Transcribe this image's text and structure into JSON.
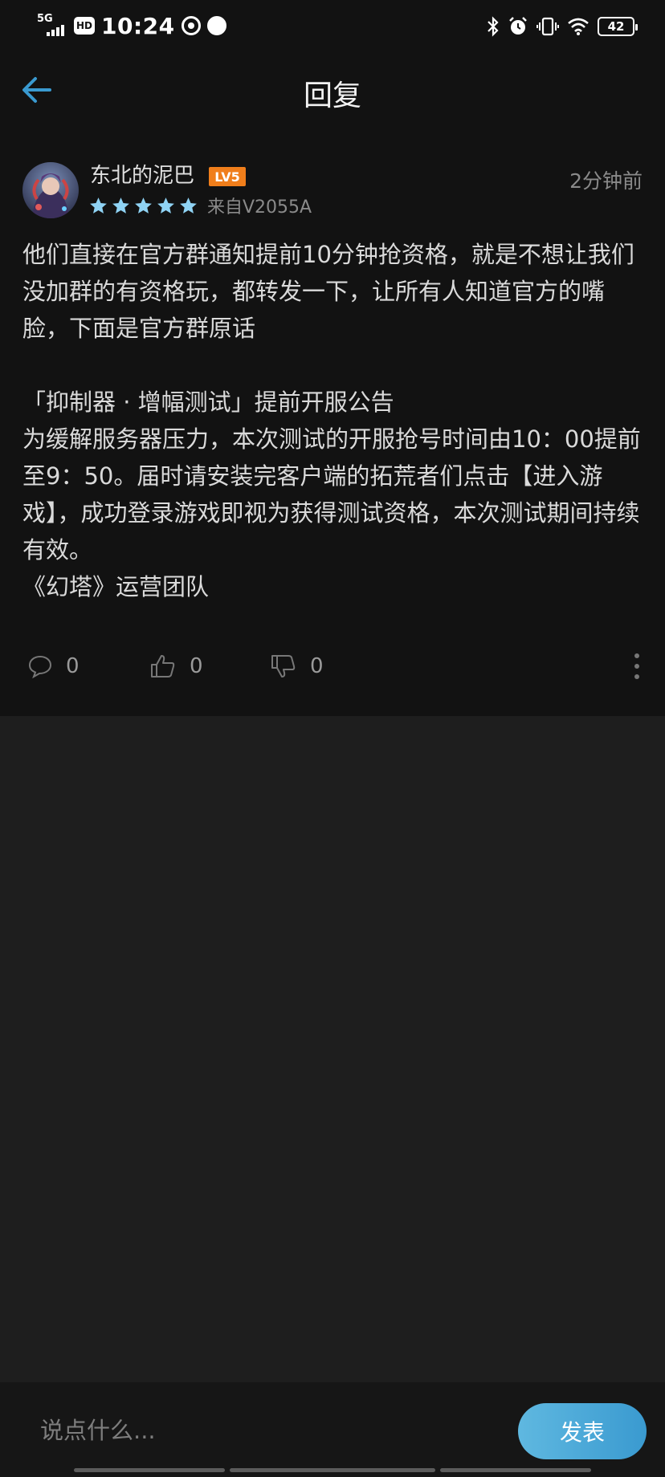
{
  "status_bar": {
    "network": "5G",
    "hd": "HD",
    "time": "10:24",
    "battery": "42"
  },
  "header": {
    "title": "回复"
  },
  "post": {
    "username": "东北的泥巴",
    "level": "LV5",
    "rating_stars": 5,
    "source": "来自V2055A",
    "time_ago": "2分钟前",
    "paragraphs": [
      "他们直接在官方群通知提前10分钟抢资格，就是不想让我们没加群的有资格玩，都转发一下，让所有人知道官方的嘴脸，下面是官方群原话",
      "",
      "「抑制器 · 增幅测试」提前开服公告",
      "为缓解服务器压力，本次测试的开服抢号时间由10：00提前至9：50。届时请安装完客户端的拓荒者们点击【进入游戏】，成功登录游戏即视为获得测试资格，本次测试期间持续有效。",
      "《幻塔》运营团队"
    ],
    "actions": {
      "comment_count": "0",
      "like_count": "0",
      "dislike_count": "0"
    }
  },
  "reply_bar": {
    "placeholder": "说点什么...",
    "send_label": "发表"
  },
  "colors": {
    "accent": "#3a9ad0",
    "level_badge": "#f07e1b",
    "star": "#8fd3f4"
  }
}
